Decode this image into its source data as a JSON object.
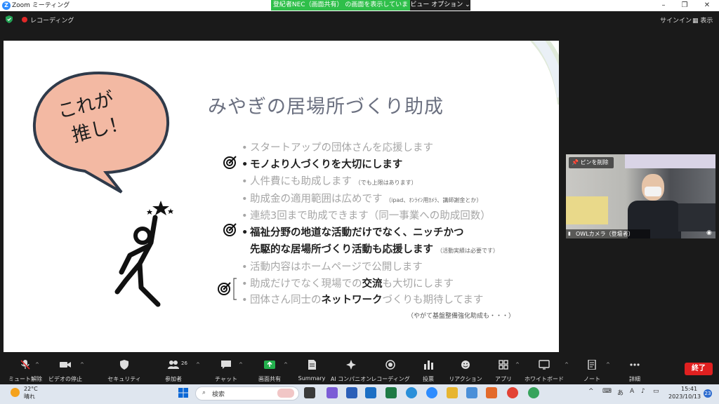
{
  "window": {
    "title": "Zoom ミーティング",
    "share_banner": "登紀者NEC（画面共有） の画面を表示しています",
    "view_options": "ビュー オプション"
  },
  "topbar": {
    "recording": "レコーディング",
    "signin": "サインイン",
    "view": "表示"
  },
  "slide": {
    "title": "みやぎの居場所づくり助成",
    "bubble_text_1": "これが",
    "bubble_text_2": "推し！",
    "bullets": [
      {
        "text": "スタートアップの団体さんを応援します"
      },
      {
        "text": "モノより人づくりを大切にします"
      },
      {
        "text": "人件費にも助成します",
        "note": "（でも上限はあります）"
      },
      {
        "text": "助成金の適用範囲は広めです",
        "note": "（ipad、ｵﾝﾗｲﾝ用ｶﾒﾗ、講師謝金とか）"
      },
      {
        "text": "連続3回まで助成できます（同一事業への助成回数）"
      },
      {
        "text": "福祉分野の地道な活動だけでなく、ニッチかつ"
      },
      {
        "text": "先駆的な居場所づくり活動も応援します",
        "note": "（活動実績は必要です）"
      },
      {
        "text": "活動内容はホームページで公開します"
      },
      {
        "pre": "助成だけでなく現場での",
        "bold": "交流",
        "post": "も大切にします"
      },
      {
        "pre": "団体さん同士の",
        "bold": "ネットワーク",
        "post": "づくりも期待してます"
      }
    ],
    "footnote": "（やがて基盤整備強化助成も・・・）"
  },
  "video": {
    "pin_label": "ピンを削除",
    "name": "OWLカメラ（登壇者）"
  },
  "toolbar": {
    "items": [
      {
        "label": "ミュート解除"
      },
      {
        "label": "ビデオの停止"
      },
      {
        "label": "セキュリティ"
      },
      {
        "label": "参加者",
        "count": "26"
      },
      {
        "label": "チャット"
      },
      {
        "label": "画面共有"
      },
      {
        "label": "Summary"
      },
      {
        "label": "AI コンパニオン"
      },
      {
        "label": "レコーディング"
      },
      {
        "label": "投票"
      },
      {
        "label": "リアクション"
      },
      {
        "label": "アプリ"
      },
      {
        "label": "ホワイトボード"
      },
      {
        "label": "ノート"
      },
      {
        "label": "詳細"
      }
    ],
    "end_label": "終了"
  },
  "taskbar": {
    "weather_temp": "22°C",
    "weather_desc": "晴れ",
    "search_placeholder": "検索",
    "time": "15:41",
    "date": "2023/10/13",
    "notifications": "23",
    "ime": "あ"
  },
  "colors": {
    "share_green": "#2fbf4a",
    "end_red": "#e02020",
    "bubble_fill": "#f3b9a3",
    "slide_title": "#6b7080"
  }
}
